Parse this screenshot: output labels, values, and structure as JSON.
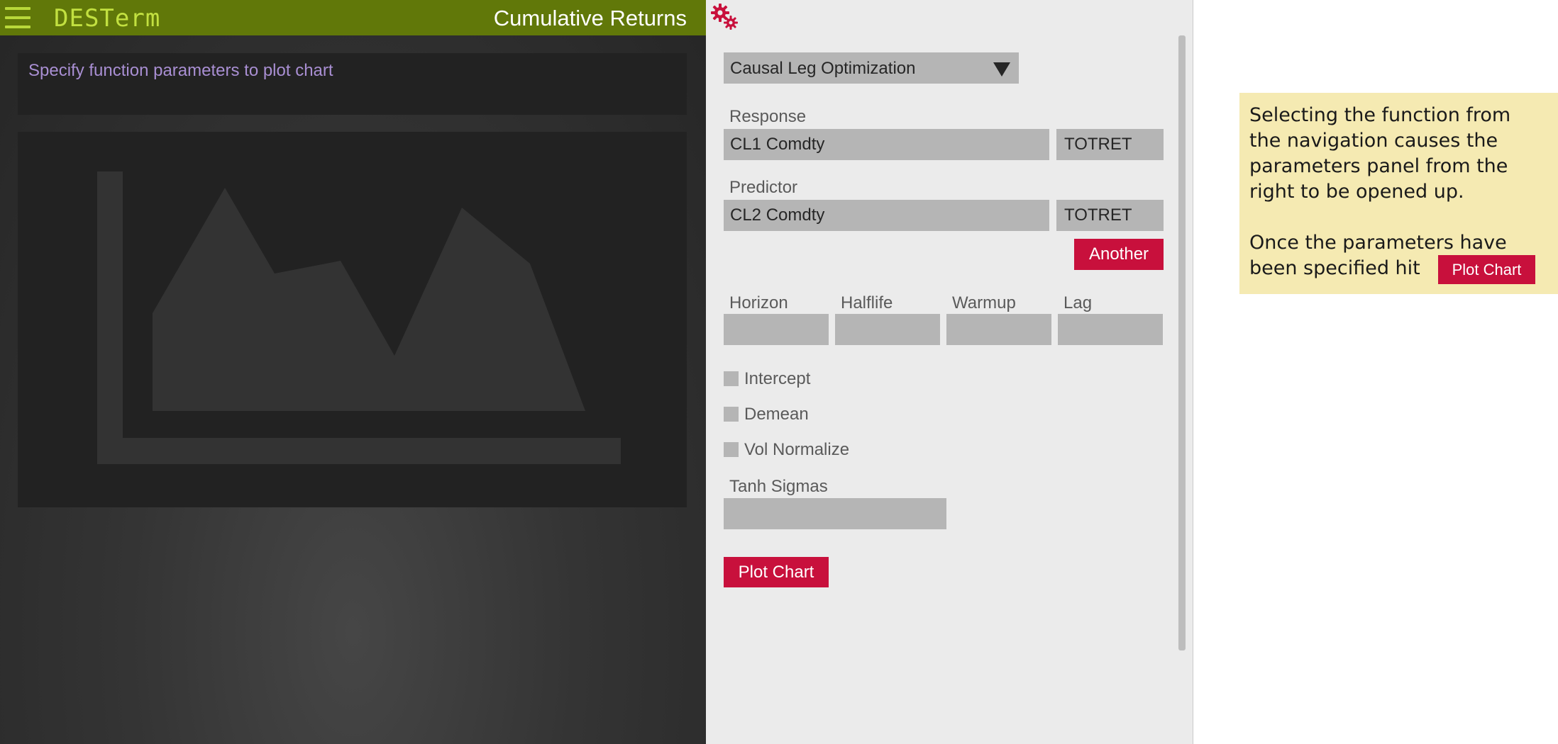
{
  "header": {
    "app_name": "DESTerm",
    "chart_title": "Cumulative Returns"
  },
  "message": {
    "text": "Specify function parameters to plot chart"
  },
  "params": {
    "function_select": "Causal Leg Optimization",
    "response": {
      "label": "Response",
      "ticker": "CL1 Comdty",
      "field": "TOTRET"
    },
    "predictor": {
      "label": "Predictor",
      "ticker": "CL2 Comdty",
      "field": "TOTRET"
    },
    "another_label": "Another",
    "horizon": {
      "label": "Horizon",
      "value": ""
    },
    "halflife": {
      "label": "Halflife",
      "value": ""
    },
    "warmup": {
      "label": "Warmup",
      "value": ""
    },
    "lag": {
      "label": "Lag",
      "value": ""
    },
    "checkboxes": [
      {
        "label": "Intercept",
        "checked": false
      },
      {
        "label": "Demean",
        "checked": false
      },
      {
        "label": "Vol Normalize",
        "checked": false
      }
    ],
    "tanh_sigmas": {
      "label": "Tanh Sigmas",
      "value": ""
    },
    "plot_label": "Plot Chart"
  },
  "help": {
    "line1": "Selecting the function from the navigation causes the parameters panel from the right to be opened up.",
    "line2": "Once the parameters have",
    "line3": "been specified hit",
    "button_label": "Plot Chart"
  },
  "colors": {
    "topbar": "#617809",
    "accent_lime": "#c2e040",
    "button_red": "#c8103c",
    "help_bg": "#f5eab2",
    "message_text": "#a98fd3"
  },
  "icons": {
    "menu": "hamburger-menu-icon",
    "settings": "gear-icon",
    "dropdown": "triangle-down-icon",
    "chart_placeholder": "area-chart-icon"
  }
}
